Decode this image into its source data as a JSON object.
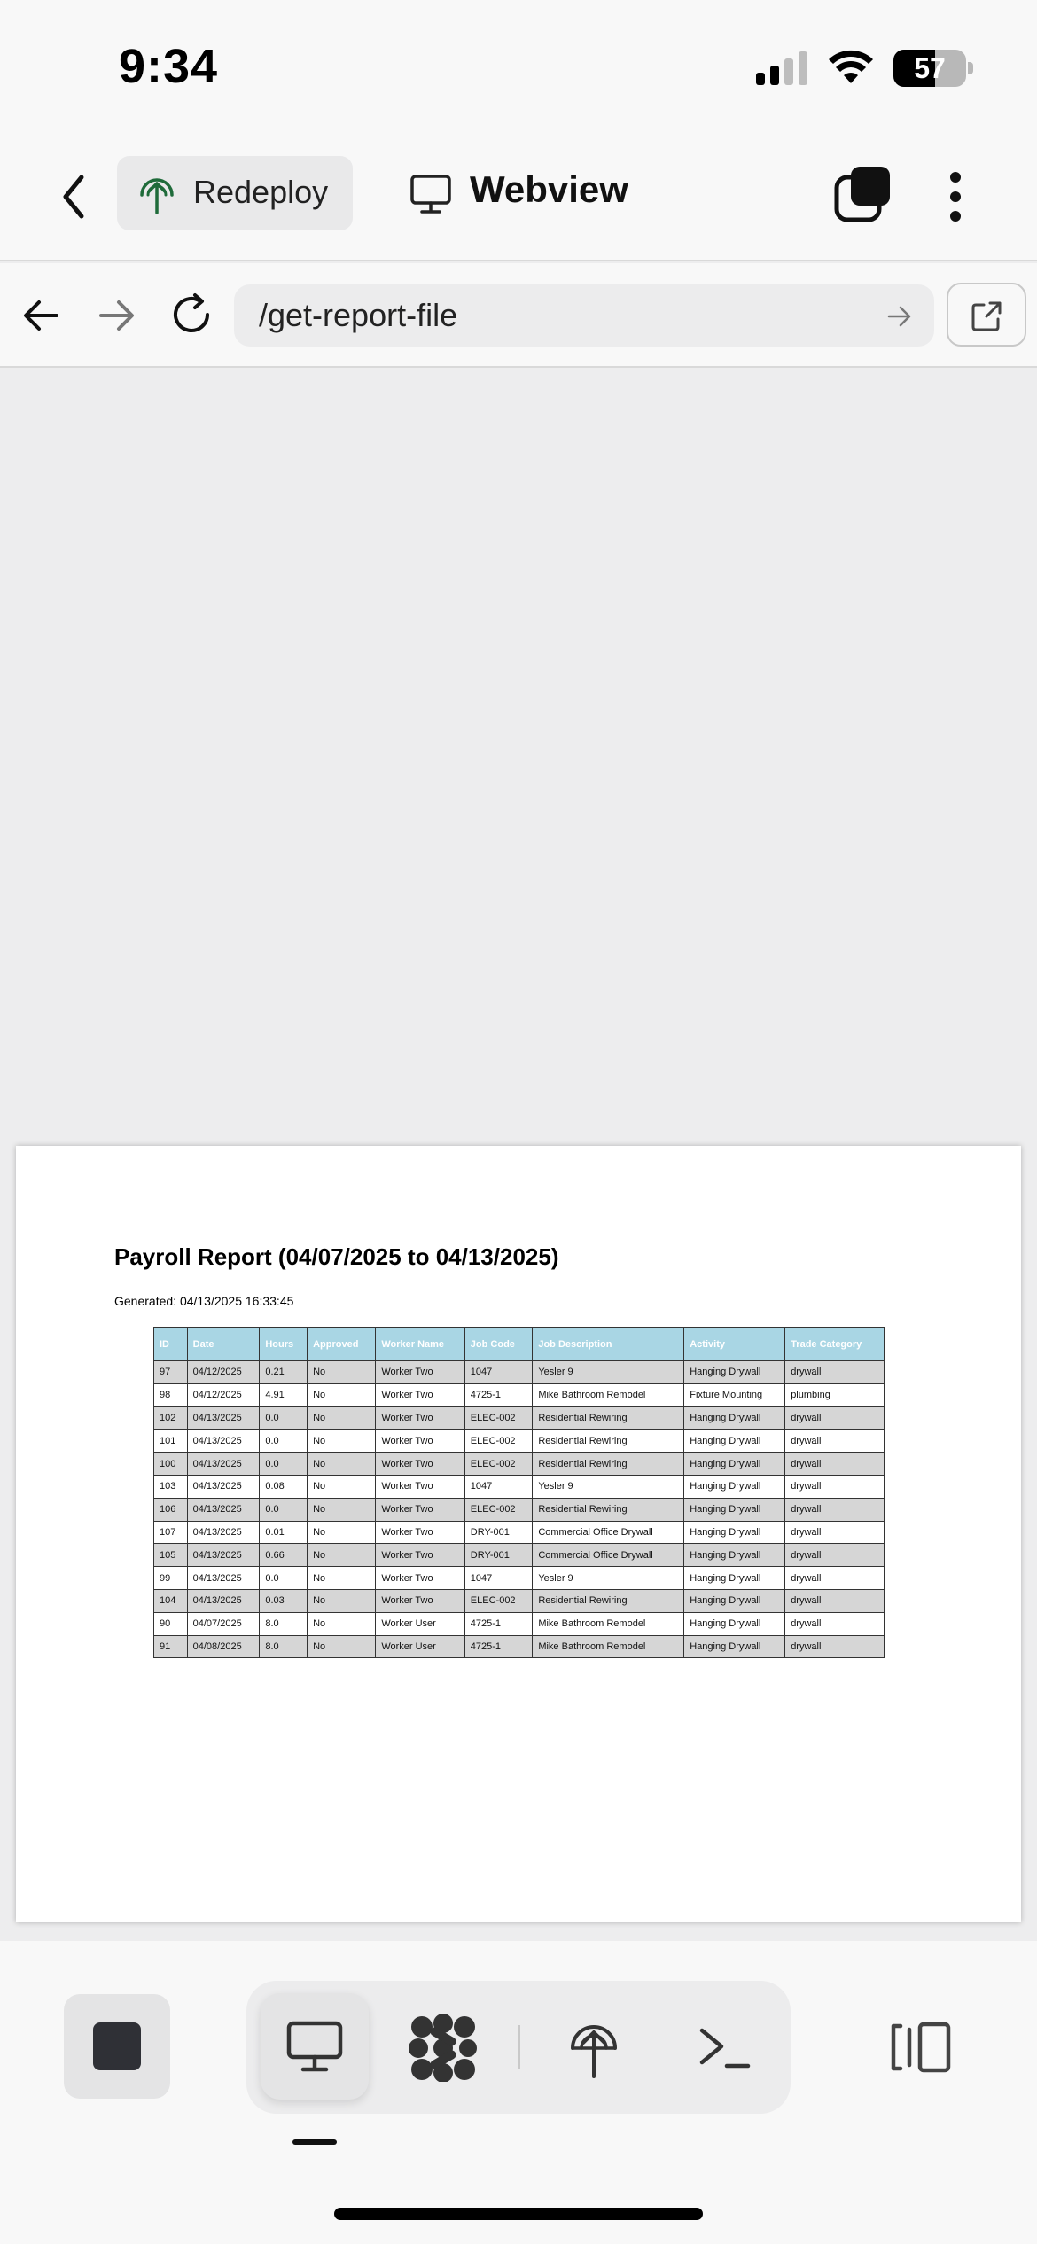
{
  "status_bar": {
    "time": "9:34",
    "battery_level": "57",
    "battery_fraction": 0.57
  },
  "header": {
    "project_label": "Redeploy",
    "view_label": "Webview"
  },
  "browser": {
    "url": "/get-report-file"
  },
  "report": {
    "title": "Payroll Report (04/07/2025 to 04/13/2025)",
    "generated": "Generated: 04/13/2025 16:33:45",
    "columns": [
      "ID",
      "Date",
      "Hours",
      "Approved",
      "Worker Name",
      "Job Code",
      "Job Description",
      "Activity",
      "Trade Category"
    ],
    "rows": [
      [
        "97",
        "04/12/2025",
        "0.21",
        "No",
        "Worker Two",
        "1047",
        "Yesler 9",
        "Hanging Drywall",
        "drywall"
      ],
      [
        "98",
        "04/12/2025",
        "4.91",
        "No",
        "Worker Two",
        "4725-1",
        "Mike Bathroom Remodel",
        "Fixture Mounting",
        "plumbing"
      ],
      [
        "102",
        "04/13/2025",
        "0.0",
        "No",
        "Worker Two",
        "ELEC-002",
        "Residential Rewiring",
        "Hanging Drywall",
        "drywall"
      ],
      [
        "101",
        "04/13/2025",
        "0.0",
        "No",
        "Worker Two",
        "ELEC-002",
        "Residential Rewiring",
        "Hanging Drywall",
        "drywall"
      ],
      [
        "100",
        "04/13/2025",
        "0.0",
        "No",
        "Worker Two",
        "ELEC-002",
        "Residential Rewiring",
        "Hanging Drywall",
        "drywall"
      ],
      [
        "103",
        "04/13/2025",
        "0.08",
        "No",
        "Worker Two",
        "1047",
        "Yesler 9",
        "Hanging Drywall",
        "drywall"
      ],
      [
        "106",
        "04/13/2025",
        "0.0",
        "No",
        "Worker Two",
        "ELEC-002",
        "Residential Rewiring",
        "Hanging Drywall",
        "drywall"
      ],
      [
        "107",
        "04/13/2025",
        "0.01",
        "No",
        "Worker Two",
        "DRY-001",
        "Commercial Office Drywall",
        "Hanging Drywall",
        "drywall"
      ],
      [
        "105",
        "04/13/2025",
        "0.66",
        "No",
        "Worker Two",
        "DRY-001",
        "Commercial Office Drywall",
        "Hanging Drywall",
        "drywall"
      ],
      [
        "99",
        "04/13/2025",
        "0.0",
        "No",
        "Worker Two",
        "1047",
        "Yesler 9",
        "Hanging Drywall",
        "drywall"
      ],
      [
        "104",
        "04/13/2025",
        "0.03",
        "No",
        "Worker Two",
        "ELEC-002",
        "Residential Rewiring",
        "Hanging Drywall",
        "drywall"
      ],
      [
        "90",
        "04/07/2025",
        "8.0",
        "No",
        "Worker User",
        "4725-1",
        "Mike Bathroom Remodel",
        "Hanging Drywall",
        "drywall"
      ],
      [
        "91",
        "04/08/2025",
        "8.0",
        "No",
        "Worker User",
        "4725-1",
        "Mike Bathroom Remodel",
        "Hanging Drywall",
        "drywall"
      ]
    ]
  },
  "bottom_bar": {
    "icons": [
      "stop-icon",
      "monitor-icon",
      "nodes-icon",
      "redeploy-icon",
      "terminal-icon",
      "panel-toggle-icon"
    ],
    "active_mode": "monitor-icon"
  },
  "colors": {
    "table_header_bg": "#a9d6e4",
    "row_shaded_bg": "#d6d6d6",
    "viewer_bg": "#ededee",
    "brand_green": "#1f6b3a"
  }
}
